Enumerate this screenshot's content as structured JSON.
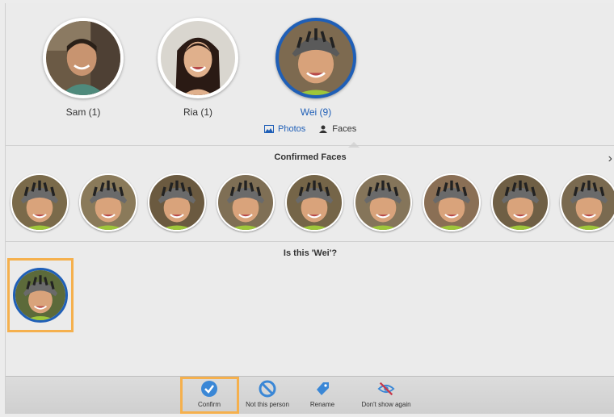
{
  "people": [
    {
      "name": "Sam (1)",
      "selected": false
    },
    {
      "name": "Ria (1)",
      "selected": false
    },
    {
      "name": "Wei (9)",
      "selected": true
    }
  ],
  "view_switch": {
    "photos_label": "Photos",
    "faces_label": "Faces",
    "active": "Photos"
  },
  "confirmed": {
    "title": "Confirmed Faces",
    "count": 9
  },
  "question": {
    "text": "Is this 'Wei'?"
  },
  "toolbar": {
    "confirm_label": "Confirm",
    "not_person_label": "Not this person",
    "rename_label": "Rename",
    "dont_show_label": "Don't show again"
  },
  "colors": {
    "accent": "#1f5fb7",
    "highlight": "#f5b04d",
    "background": "#ebebeb"
  }
}
